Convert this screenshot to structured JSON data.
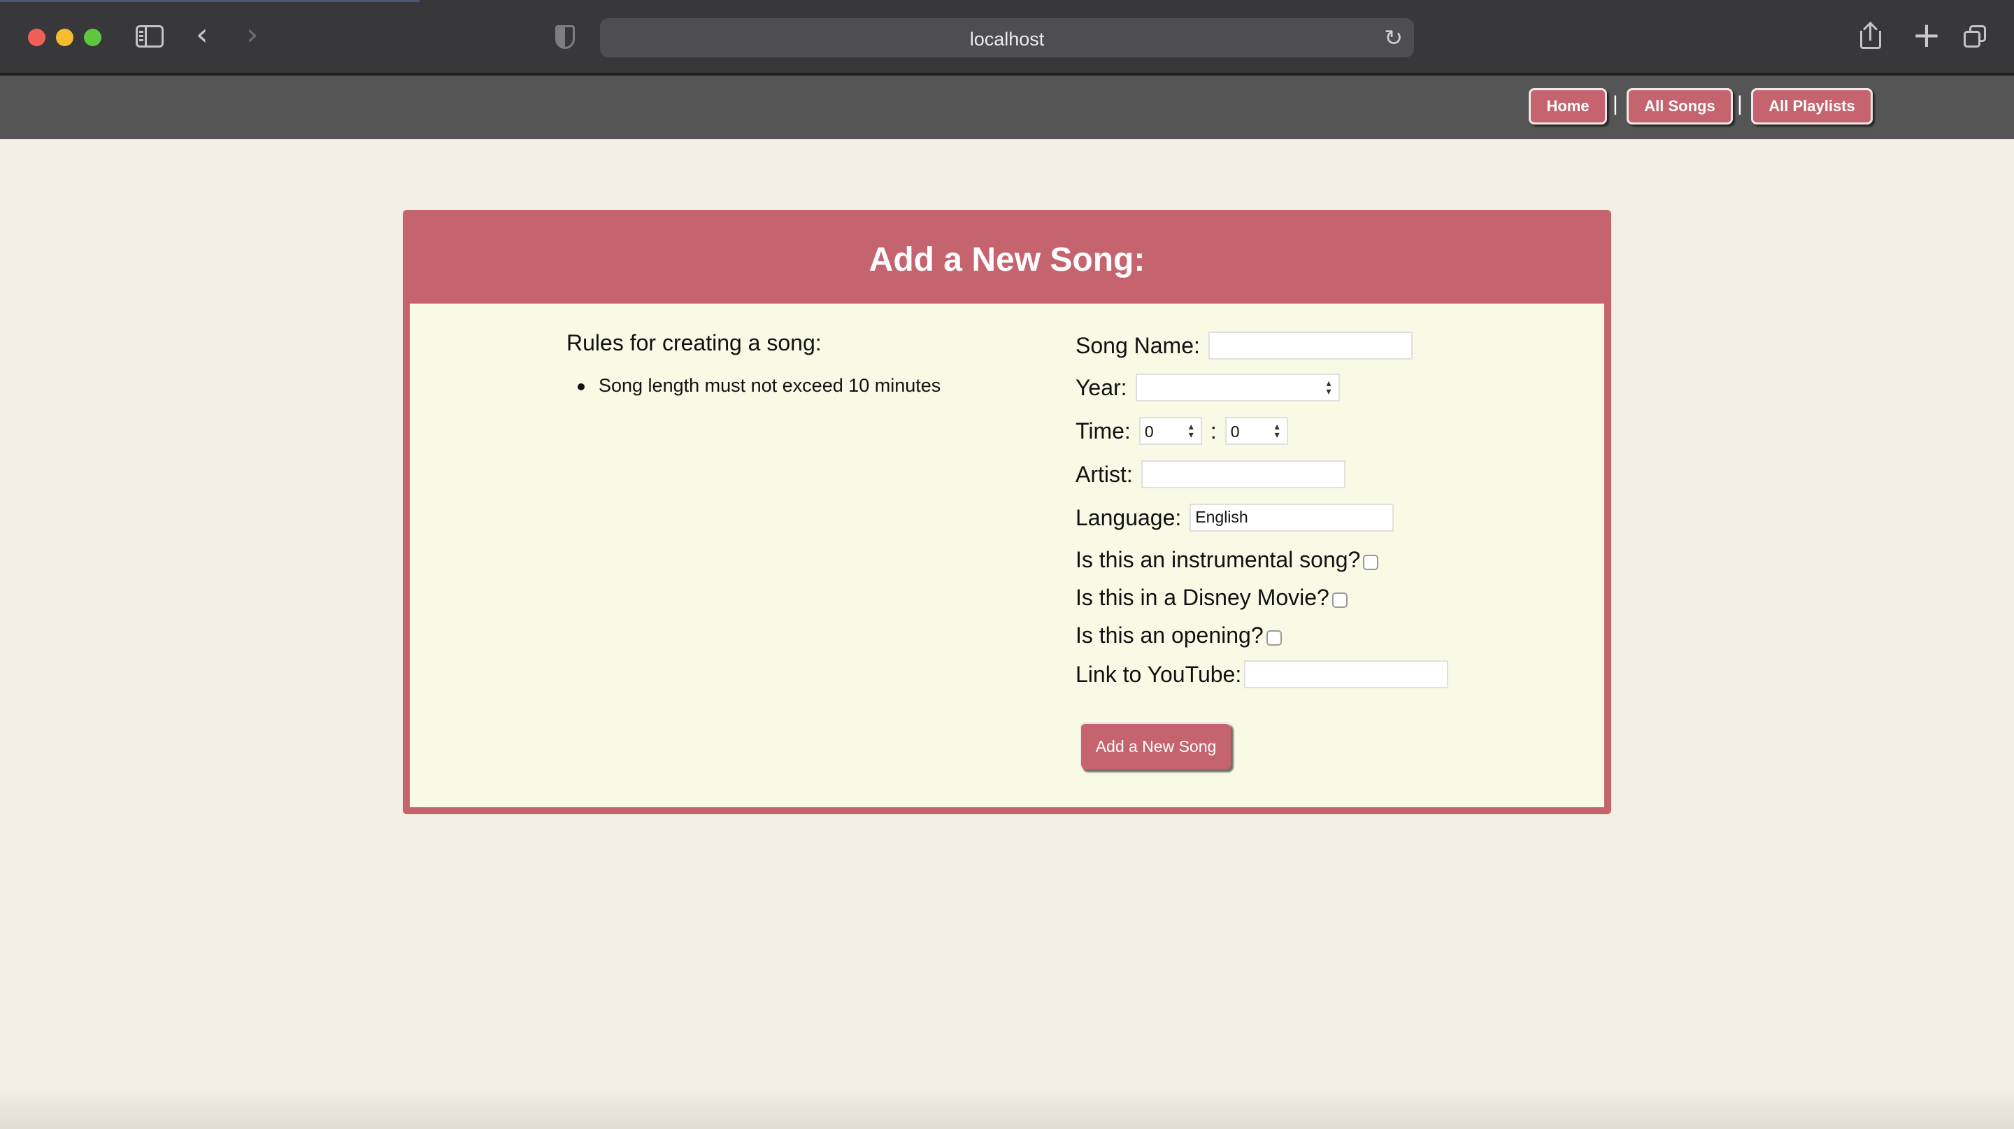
{
  "browser": {
    "url": "localhost",
    "icons": [
      "sidebar-icon",
      "back-arrow-icon",
      "forward-arrow-icon",
      "shield-icon",
      "reload-icon",
      "share-icon",
      "new-tab-icon",
      "tab-overview-icon"
    ]
  },
  "nav": {
    "home_label": "Home",
    "songs_label": "All Songs",
    "playlists_label": "All Playlists",
    "separator": "|"
  },
  "card": {
    "title": "Add a New Song:"
  },
  "rules": {
    "title": "Rules for creating a song:",
    "items": [
      "Song length must not exceed 10 minutes"
    ]
  },
  "form": {
    "song_name_label": "Song Name:",
    "song_name_value": "",
    "year_label": "Year:",
    "year_value": "",
    "time_label": "Time:",
    "time_minutes": "0",
    "time_seconds": "0",
    "time_separator": ":",
    "artist_label": "Artist:",
    "artist_value": "",
    "language_label": "Language:",
    "language_value": "English",
    "instrumental_label": "Is this an instrumental song?",
    "disney_label": "Is this in a Disney Movie?",
    "opening_label": "Is this an opening?",
    "youtube_label": "Link to YouTube:",
    "youtube_value": "",
    "submit_label": "Add a New Song"
  },
  "colors": {
    "accent": "#c5646f",
    "page_background": "#f3efe4",
    "card_body": "#f9fae6",
    "nav_bar": "#555555",
    "chrome": "#38373a"
  }
}
